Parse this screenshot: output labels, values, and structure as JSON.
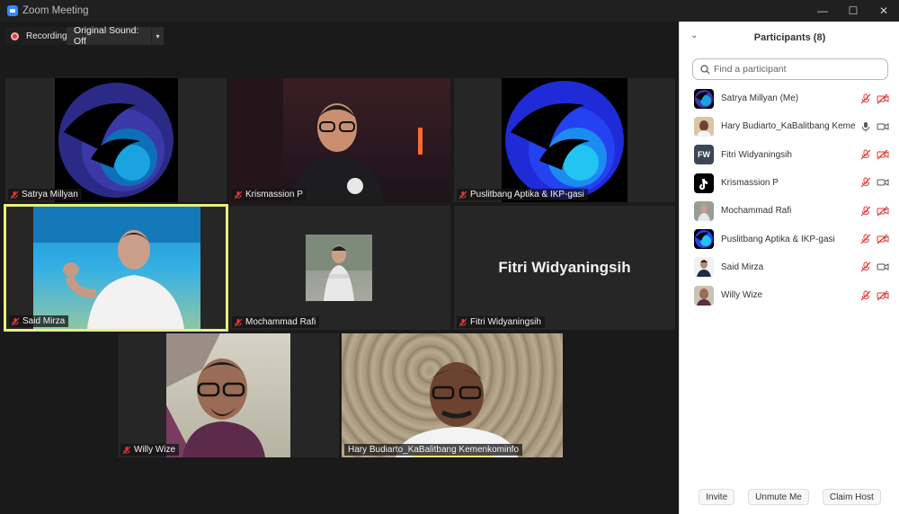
{
  "window": {
    "title": "Zoom Meeting",
    "controls": {
      "minimize": "—",
      "maximize": "☐",
      "close": "✕"
    }
  },
  "toolbar": {
    "recording_label": "Recording",
    "sound_label": "Original Sound: Off",
    "sound_caret": "▾"
  },
  "tiles": [
    {
      "name": "Satrya Millyan"
    },
    {
      "name": "Krismassion P"
    },
    {
      "name": "Puslitbang Aptika & IKP-gasi"
    },
    {
      "name": "Said Mirza"
    },
    {
      "name": "Mochammad Rafi"
    },
    {
      "name": "Fitri Widyaningsih",
      "placeholder_text": "Fitri Widyaningsih"
    },
    {
      "name": "Willy Wize"
    },
    {
      "name": "Hary Budiarto_KaBalitbang Kemenkominfo"
    }
  ],
  "panel": {
    "collapse": "⌄",
    "title": "Participants (8)",
    "search_placeholder": "Find a participant",
    "participants": [
      {
        "name": "Satrya Millyan (Me)",
        "mic": "muted",
        "video": "off"
      },
      {
        "name": "Hary Budiarto_KaBalitbang Kemen...",
        "mic": "on",
        "video": "on"
      },
      {
        "name": "Fitri Widyaningsih",
        "initials": "FW",
        "mic": "muted",
        "video": "off"
      },
      {
        "name": "Krismassion P",
        "mic": "muted",
        "video": "on"
      },
      {
        "name": "Mochammad Rafi",
        "mic": "muted",
        "video": "off"
      },
      {
        "name": "Puslitbang Aptika & IKP-gasi",
        "mic": "muted",
        "video": "off"
      },
      {
        "name": "Said Mirza",
        "mic": "muted",
        "video": "on"
      },
      {
        "name": "Willy Wize",
        "mic": "muted",
        "video": "off"
      }
    ],
    "buttons": {
      "invite": "Invite",
      "unmute": "Unmute Me",
      "claim_host": "Claim Host"
    }
  },
  "colors": {
    "accent": "#2D8CFF",
    "active_speaker": "#E9F07A",
    "muted_red": "#E03A3A"
  }
}
